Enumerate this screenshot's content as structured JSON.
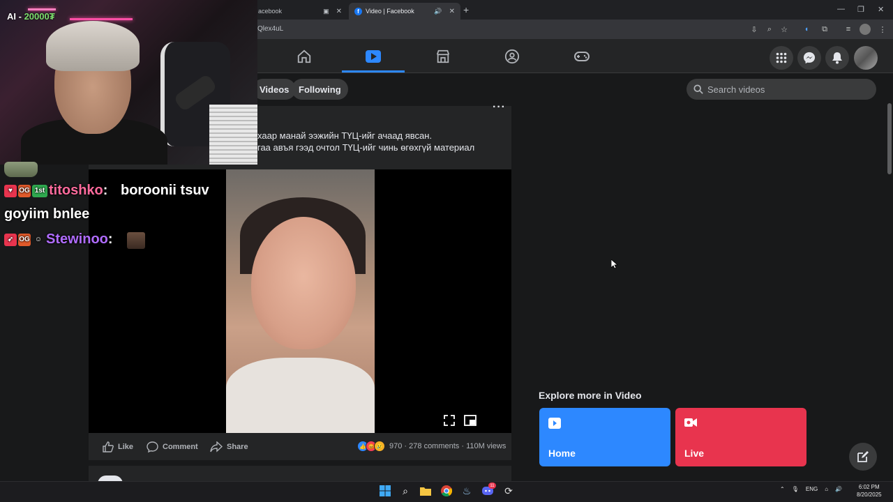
{
  "browser": {
    "tabs": [
      {
        "label": "acebook",
        "active": false
      },
      {
        "label": "Video | Facebook",
        "active": true
      }
    ],
    "url": "Qlex4uL"
  },
  "facebook": {
    "nav": [
      "home-icon",
      "video-icon",
      "marketplace-icon",
      "groups-icon",
      "gaming-icon"
    ],
    "active_nav": "video-icon",
    "subnav": {
      "videos_label": "Videos",
      "following_label": "Following"
    },
    "search": {
      "placeholder": "Search videos"
    },
    "post": {
      "caption_line1": "хаар манай ээжийн ТҮЦ-ийг ачаад явсан.",
      "caption_line2": "гаа авъя гээд очтол ТҮЦ-ийг чинь өгөхгүй материал",
      "like_label": "Like",
      "comment_label": "Comment",
      "share_label": "Share",
      "reaction_count": "970",
      "comments": "278 comments",
      "views": "110M views"
    },
    "explore": {
      "title": "Explore more in Video",
      "cards": [
        {
          "label": "Home",
          "color": "#2d88ff"
        },
        {
          "label": "Live",
          "color": "#e8344e"
        }
      ]
    }
  },
  "stream_overlay": {
    "cam_label_prefix": "AI - ",
    "cam_label_amount": "20000₮",
    "chat": [
      {
        "user": "titoshko",
        "user_color": "#ff6b9d",
        "message": "boroonii tsuv goyiim bnlee"
      },
      {
        "user": "Stewinoo",
        "user_color": "#b06cff",
        "message": ""
      }
    ],
    "badges": {
      "og": "OG",
      "first": "1st"
    }
  },
  "taskbar": {
    "tray_lang": "ENG",
    "time": "6:02 PM",
    "date": "8/20/2025",
    "discord_badge": "11"
  }
}
